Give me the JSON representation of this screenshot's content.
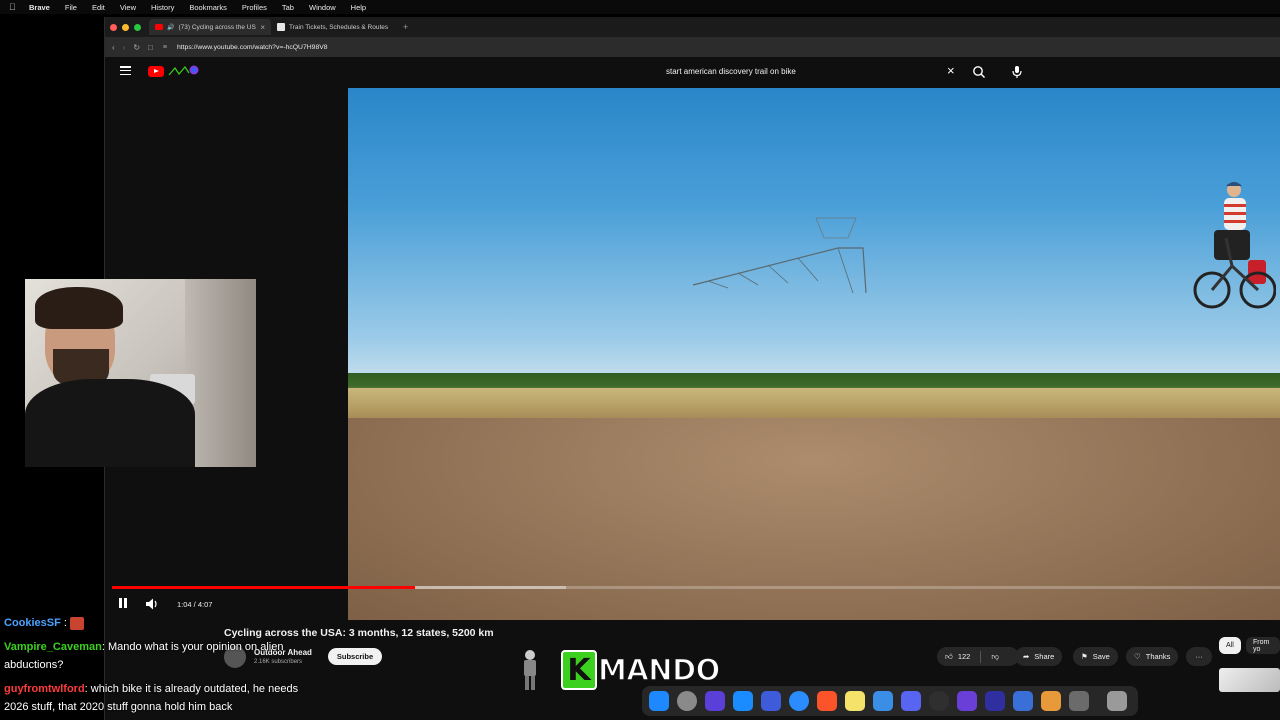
{
  "menubar": {
    "items": [
      "Brave",
      "File",
      "Edit",
      "View",
      "History",
      "Bookmarks",
      "Profiles",
      "Tab",
      "Window",
      "Help"
    ]
  },
  "browser": {
    "tabs": [
      {
        "title": "(73) Cycling across the USA"
      },
      {
        "title": "Train Tickets, Schedules & Routes"
      }
    ],
    "url": "https://www.youtube.com/watch?v=-hcQU7H98V8"
  },
  "youtube": {
    "search_query": "start american discovery trail on bike",
    "player": {
      "time": "1:04 / 4:07",
      "progress": 0.259
    },
    "video": {
      "title": "Cycling across the USA: 3 months, 12 states, 5200 km",
      "channel": "Outdoor Ahead",
      "subscribers": "2.16K subscribers",
      "subscribe_label": "Subscribe",
      "likes": "122",
      "share_label": "Share",
      "save_label": "Save",
      "thanks_label": "Thanks",
      "more_label": "···"
    },
    "chips": [
      "All",
      "From yo"
    ]
  },
  "chat": [
    {
      "user": "CookiesSF",
      "color": "#4aa3ff",
      "message": ""
    },
    {
      "user": "Vampire_Caveman",
      "color": "#3cd11f",
      "message": ": Mando what is your opinion on alien abductions?"
    },
    {
      "user": "guyfromtwlford",
      "color": "#ff3b3b",
      "message": ": which bike it is already outdated, he needs 2026 stuff, that 2020 stuff gonna hold him back"
    }
  ],
  "streamer": {
    "badge_letter": "K",
    "name": "MANDO"
  },
  "colors": {
    "youtube_red": "#ff0000",
    "accent_green": "#3cd11f"
  }
}
